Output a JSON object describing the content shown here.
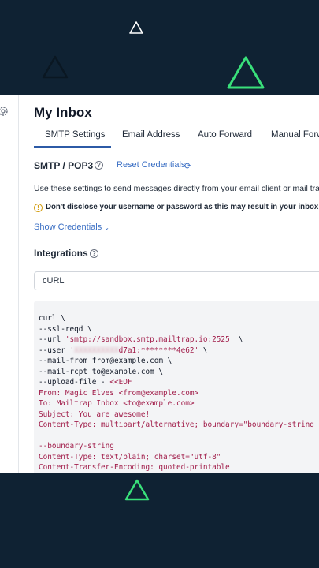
{
  "colors": {
    "background": "#0f2233",
    "accent_green": "#39e07a",
    "link": "#3b6fc4",
    "tab_active": "#2c5aa6",
    "code_string": "#a11d4a"
  },
  "page": {
    "title": "My Inbox"
  },
  "tabs": [
    {
      "label": "SMTP Settings",
      "active": true
    },
    {
      "label": "Email Address"
    },
    {
      "label": "Auto Forward"
    },
    {
      "label": "Manual Forw"
    }
  ],
  "smtp": {
    "heading": "SMTP / POP3",
    "reset_label": "Reset Credentials",
    "description": "Use these settings to send messages directly from your email client or mail trans",
    "warning": "Don't disclose your username or password as this may result in your inbox getting",
    "show_credentials": "Show Credentials"
  },
  "integrations": {
    "heading": "Integrations",
    "selected": "cURL"
  },
  "code": {
    "l1": "curl \\",
    "l2": "--ssl-reqd \\",
    "l3_pre": "--url ",
    "l3_str": "'smtp://sandbox.smtp.mailtrap.io:2525'",
    "l3_post": " \\",
    "l4_pre": "--user ",
    "l4_q": "'",
    "l4_blur": "XXXXXXXXXX",
    "l4_str": "d7a1:********4e62'",
    "l4_post": " \\",
    "l5": "--mail-from from@example.com \\",
    "l6": "--mail-rcpt to@example.com \\",
    "l7_pre": "--upload-file - ",
    "l7_str": "<<EOF",
    "l8": "From: Magic Elves <from@example.com>",
    "l9": "To: Mailtrap Inbox <to@example.com>",
    "l10": "Subject: You are awesome!",
    "l11": "Content-Type: multipart/alternative; boundary=\"boundary-string",
    "l12": "",
    "l13": "--boundary-string",
    "l14": "Content-Type: text/plain; charset=\"utf-8\"",
    "l15": "Content-Transfer-Encoding: quoted-printable"
  }
}
